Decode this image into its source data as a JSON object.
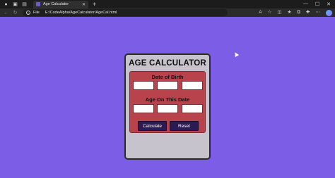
{
  "browser": {
    "tab_title": "Age Calculator",
    "tab_close": "✕",
    "new_tab": "+",
    "window_controls": [
      "—",
      "☐",
      "✕"
    ],
    "address": {
      "scheme_label": "File",
      "url": "E:/CodeAlpha/AgeCalculator/AgeCal.html"
    },
    "icons": [
      "back-icon",
      "refresh-icon",
      "read-aloud-icon",
      "favorites-icon",
      "split-screen-icon",
      "collections-icon",
      "extensions-icon",
      "more-icon",
      "copilot-icon"
    ]
  },
  "page": {
    "background": "#7b5de6",
    "card": {
      "title": "AGE CALCULATOR",
      "dob_label": "Date of Birth",
      "target_label": "Age On This Date",
      "dob_fields": [
        "",
        "",
        ""
      ],
      "target_fields": [
        "",
        "",
        ""
      ],
      "calculate_label": "Calculate",
      "reset_label": "Reset"
    }
  },
  "colors": {
    "card": "#c7c3cd",
    "panel": "#b8434d",
    "button": "#2c1a52",
    "accent": "#6a5acd"
  }
}
